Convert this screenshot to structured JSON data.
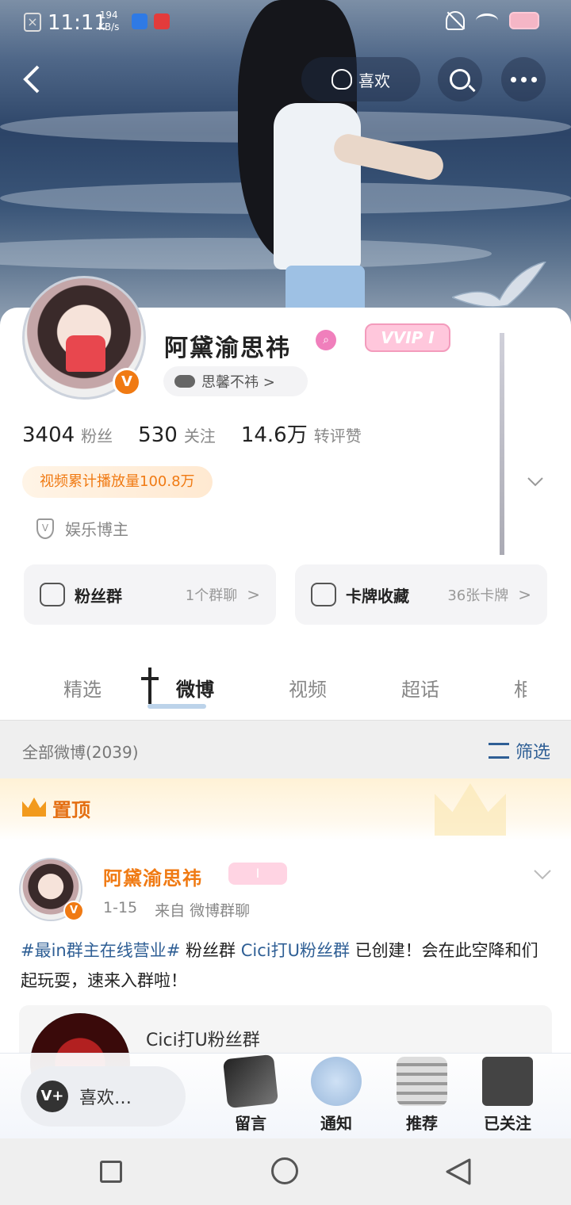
{
  "status_bar": {
    "time": "11:11",
    "speed_value": "194",
    "speed_unit": "KB/s"
  },
  "nav": {
    "like_label": "喜欢"
  },
  "profile": {
    "name": "阿黛渝思祎",
    "vip_label": "VVIP I",
    "group_chip": "思馨不祎 >",
    "verified_badge": "V",
    "stats": [
      {
        "value": "3404",
        "label": "粉丝"
      },
      {
        "value": "530",
        "label": "关注"
      },
      {
        "value": "14.6万",
        "label": "转评赞"
      }
    ],
    "video_plays": "视频累计播放量100.8万",
    "tag": "娱乐博主",
    "fans_box": {
      "title": "粉丝群",
      "sub": "1个群聊",
      "arrow": ">"
    },
    "cards_box": {
      "title": "卡牌收藏",
      "sub": "36张卡牌",
      "arrow": ">"
    }
  },
  "tabs": [
    "精选",
    "微博",
    "视频",
    "超话",
    "相"
  ],
  "filter_bar": {
    "all_label": "全部微博(2039)",
    "filter_label": "筛选"
  },
  "pinned": {
    "label": "置顶"
  },
  "post": {
    "author": "阿黛渝思祎",
    "vip": "I",
    "date": "1-15",
    "source": "来自 微博群聊",
    "text_link1": "#最in群主在线营业#",
    "text_mid1": "粉丝群",
    "text_link2": "Cici打U粉丝群",
    "text_rest": " 已创建！会在此空降和们起玩耍，速来入群啦！",
    "embed_title": "Cici打U粉丝群"
  },
  "bottom_bar": {
    "like_label": "喜欢…",
    "items": [
      "留言",
      "通知",
      "推荐",
      "已关注"
    ]
  },
  "colors": {
    "accent_orange": "#f07a13",
    "link_blue": "#2f5f95",
    "vip_pink": "#ffc7dc"
  }
}
